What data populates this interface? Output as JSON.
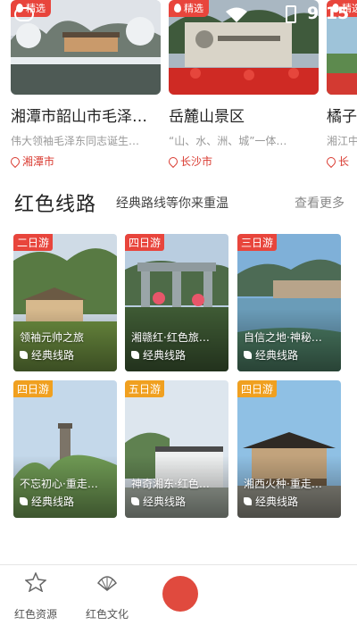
{
  "status": {
    "time": "9:15"
  },
  "scenic_spots": [
    {
      "badge": "精选",
      "name": "湘潭市韶山市毛泽东…",
      "desc": "伟大领袖毛泽东同志诞生…",
      "location": "湘潭市"
    },
    {
      "badge": "精选",
      "name": "岳麓山景区",
      "desc": "“山、水、洲、城”一体…",
      "location": "长沙市"
    },
    {
      "badge": "精选",
      "name": "橘子",
      "desc": "湘江中",
      "location": "长"
    }
  ],
  "section": {
    "title": "红色线路",
    "subtitle": "经典路线等你来重温",
    "more": "查看更多"
  },
  "routes": [
    {
      "days": "二日游",
      "title": "领袖元帅之旅",
      "kind": "经典线路",
      "tag_color": "#e8453c"
    },
    {
      "days": "四日游",
      "title": "湘赣红·红色旅…",
      "kind": "经典线路",
      "tag_color": "#e8453c"
    },
    {
      "days": "三日游",
      "title": "自信之地·神秘…",
      "kind": "经典线路",
      "tag_color": "#e8453c"
    },
    {
      "days": "四日游",
      "title": "不忘初心·重走…",
      "kind": "经典线路",
      "tag_color": "#f0a020"
    },
    {
      "days": "五日游",
      "title": "神奇湘东·红色…",
      "kind": "经典线路",
      "tag_color": "#f0a020"
    },
    {
      "days": "四日游",
      "title": "湘西火种·重走…",
      "kind": "经典线路",
      "tag_color": "#f0a020"
    }
  ],
  "nav": {
    "items": [
      {
        "label": "红色资源",
        "icon": "star-icon"
      },
      {
        "label": "红色文化",
        "icon": "fan-icon"
      }
    ]
  },
  "colors": {
    "accent": "#e8453c",
    "accent_location": "#d9392f",
    "tag_orange": "#f0a020"
  }
}
